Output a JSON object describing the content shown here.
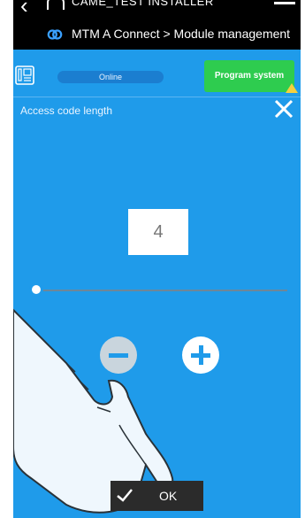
{
  "status_bar": {
    "installer_name": "CAME_TEST INSTALLER",
    "icons": [
      "back-icon",
      "home-icon",
      "menu-icon"
    ]
  },
  "breadcrumb": {
    "text": "MTM A Connect > Module management",
    "icon": "came-connect-logo"
  },
  "toolbar": {
    "status_label": "Online",
    "program_button_label": "Program system",
    "icons": [
      "device-monitor-icon",
      "warning-icon"
    ]
  },
  "panel": {
    "title": "Access code length",
    "value": "4",
    "slider_value_percent": 0,
    "ok_label": "OK",
    "icons": [
      "close-icon",
      "minus-icon",
      "plus-icon",
      "check-icon"
    ]
  },
  "colors": {
    "background": "#1f9bea",
    "program_button": "#2ecc4f",
    "ok_button": "#2b2b2b",
    "warning": "#f4d03f"
  }
}
